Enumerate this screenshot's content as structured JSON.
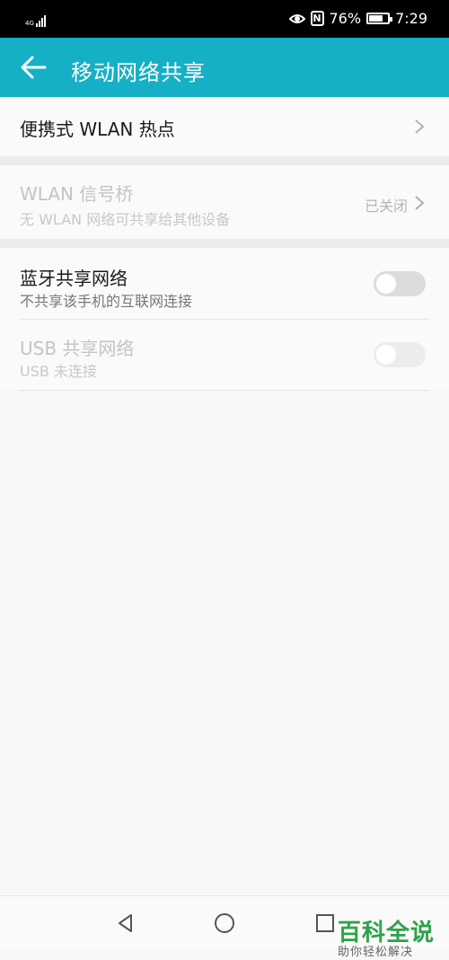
{
  "status_bar": {
    "network_type": "4G",
    "battery": "76%",
    "battery_level": 0.76,
    "time": "7:29"
  },
  "app_bar": {
    "title": "移动网络共享"
  },
  "rows": {
    "hotspot": {
      "title": "便携式 WLAN 热点"
    },
    "wlan_bridge": {
      "title": "WLAN 信号桥",
      "subtitle": "无 WLAN 网络可共享给其他设备",
      "value": "已关闭"
    },
    "bluetooth": {
      "title": "蓝牙共享网络",
      "subtitle": "不共享该手机的互联网连接",
      "enabled": false
    },
    "usb": {
      "title": "USB 共享网络",
      "subtitle": "USB 未连接",
      "enabled": false
    }
  },
  "watermark": {
    "main": "百科全说",
    "sub": "助你轻松解决"
  },
  "colors": {
    "accent": "#15b0c6",
    "watermark_green": "#2ea24a"
  },
  "icons": [
    "back-arrow-icon",
    "chevron-right-icon",
    "eye-icon",
    "nfc-icon",
    "battery-icon",
    "signal-icon"
  ]
}
